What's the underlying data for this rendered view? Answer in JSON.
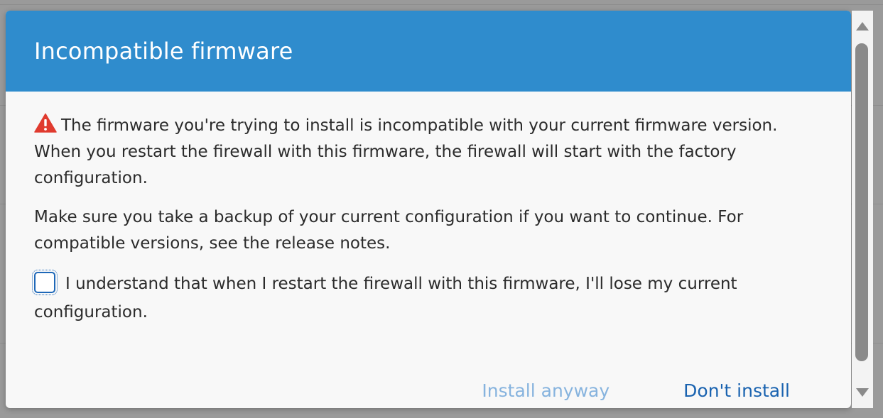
{
  "dialog": {
    "title": "Incompatible firmware",
    "warning_text": "The firmware you're trying to install is incompatible with your current firmware version. When you restart the firewall with this firmware, the firewall will start with the factory configuration.",
    "backup_text": "Make sure you take a backup of your current configuration if you want to continue. For compatible versions, see the release notes.",
    "checkbox_label": "I understand that when I restart the firewall with this firmware, I'll lose my current configuration.",
    "checkbox_checked": false,
    "warning_icon": "warning-triangle-icon",
    "buttons": {
      "install_anyway": "Install anyway",
      "dont_install": "Don't install"
    }
  },
  "colors": {
    "header": "#2f8ccd",
    "warning": "#e03b2f",
    "primary_link": "#1a63b0",
    "disabled_link": "#86b3de"
  }
}
